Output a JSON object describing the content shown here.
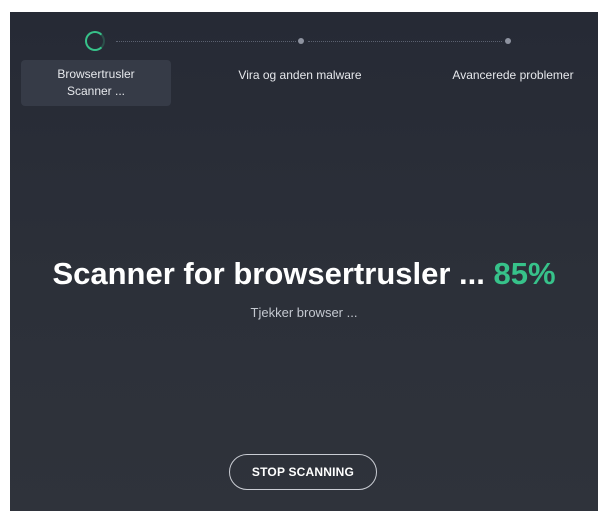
{
  "steps": [
    {
      "label_line1": "Browsertrusler",
      "label_line2": "Scanner ...",
      "state": "active"
    },
    {
      "label_line1": "Vira og anden malware",
      "state": "pending"
    },
    {
      "label_line1": "Avancerede problemer",
      "state": "pending"
    }
  ],
  "scan": {
    "title": "Scanner for browsertrusler ...",
    "percent": "85%",
    "status": "Tjekker browser ..."
  },
  "actions": {
    "stop_label": "STOP SCANNING"
  },
  "colors": {
    "accent": "#37c28a",
    "background": "#2a2e38",
    "text": "#ffffff"
  },
  "icons": {
    "active_step": "spinner-ring-icon",
    "pending_step": "dot-icon"
  }
}
